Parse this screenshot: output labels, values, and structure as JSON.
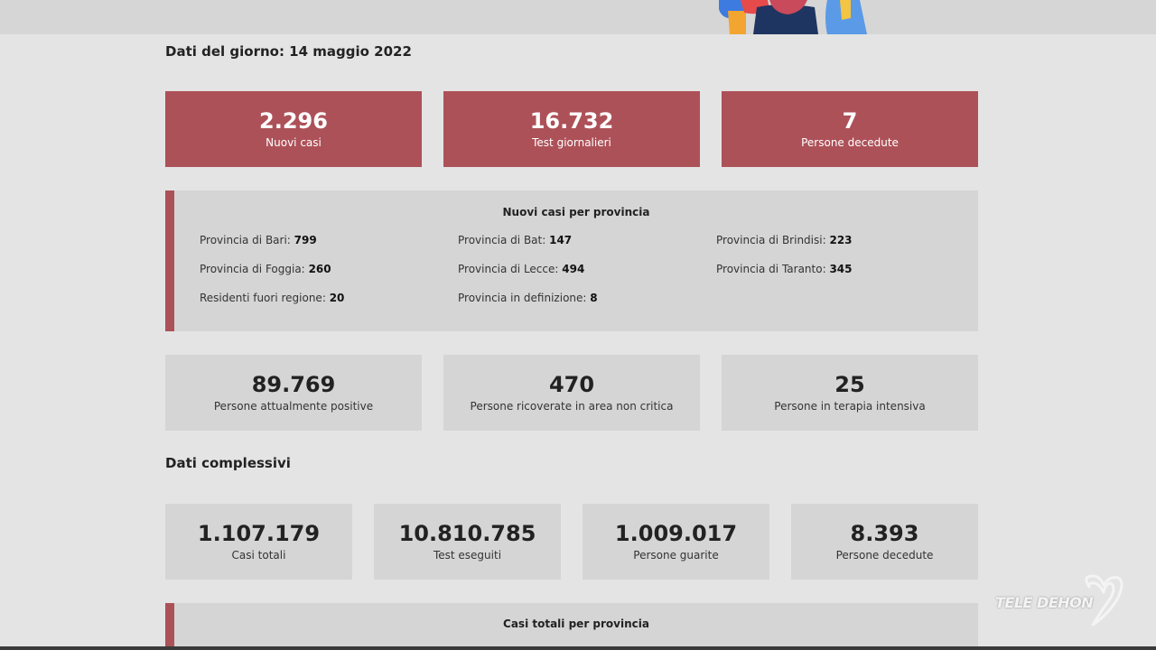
{
  "daily": {
    "title": "Dati del giorno: 14 maggio 2022",
    "highlights": [
      {
        "value": "2.296",
        "label": "Nuovi casi"
      },
      {
        "value": "16.732",
        "label": "Test giornalieri"
      },
      {
        "value": "7",
        "label": "Persone decedute"
      }
    ],
    "provinces": {
      "title": "Nuovi casi per provincia",
      "items": [
        {
          "name": "Provincia di Bari:",
          "value": "799"
        },
        {
          "name": "Provincia di Bat:",
          "value": "147"
        },
        {
          "name": "Provincia di Brindisi:",
          "value": "223"
        },
        {
          "name": "Provincia di Foggia:",
          "value": "260"
        },
        {
          "name": "Provincia di Lecce:",
          "value": "494"
        },
        {
          "name": "Provincia di Taranto:",
          "value": "345"
        },
        {
          "name": "Residenti fuori regione:",
          "value": "20"
        },
        {
          "name": "Provincia in definizione:",
          "value": "8"
        }
      ]
    },
    "status": [
      {
        "value": "89.769",
        "label": "Persone attualmente positive"
      },
      {
        "value": "470",
        "label": "Persone ricoverate in area non critica"
      },
      {
        "value": "25",
        "label": "Persone in terapia intensiva"
      }
    ]
  },
  "overall": {
    "title": "Dati complessivi",
    "totals": [
      {
        "value": "1.107.179",
        "label": "Casi totali"
      },
      {
        "value": "10.810.785",
        "label": "Test eseguiti"
      },
      {
        "value": "1.009.017",
        "label": "Persone guarite"
      },
      {
        "value": "8.393",
        "label": "Persone decedute"
      }
    ],
    "provinces_title": "Casi totali per provincia"
  },
  "watermark": {
    "text": "TELE DEHON",
    "icon": "heart-logo-icon"
  },
  "colors": {
    "accent": "#ad5158",
    "card_grey": "#d5d5d5",
    "background": "#e4e4e4"
  }
}
